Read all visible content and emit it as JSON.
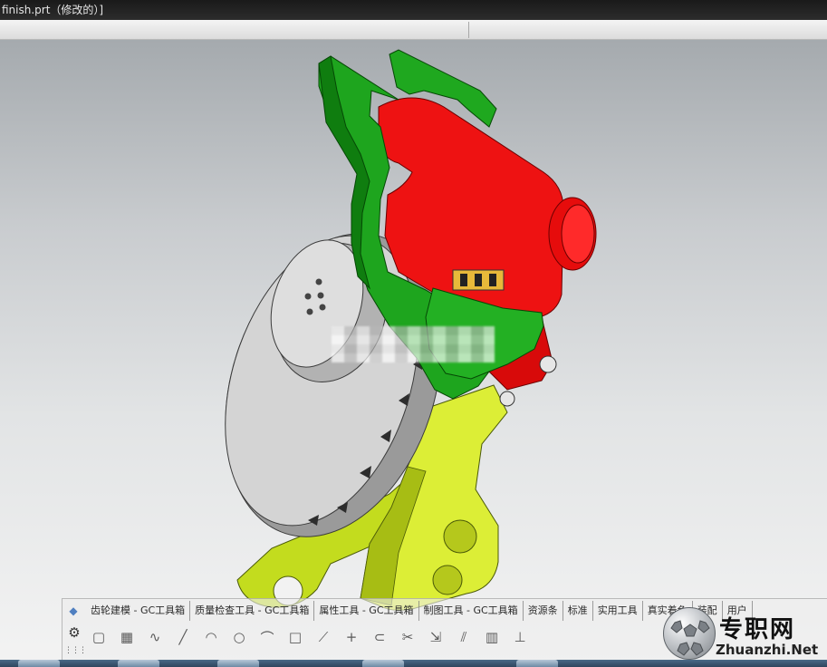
{
  "window": {
    "title": "finish.prt（修改的）]"
  },
  "ribbon": {
    "tabs": [
      "齿轮建模 - GC工具箱",
      "质量检查工具 - GC工具箱",
      "属性工具 - GC工具箱",
      "制图工具 - GC工具箱",
      "资源条",
      "标准",
      "实用工具",
      "真实着色",
      "装配",
      "用户"
    ],
    "tools": [
      {
        "name": "rectangle-select-icon",
        "glyph": "▢"
      },
      {
        "name": "grid-icon",
        "glyph": "▦"
      },
      {
        "name": "spline-icon",
        "glyph": "∿"
      },
      {
        "name": "line-icon",
        "glyph": "╱"
      },
      {
        "name": "arc-icon",
        "glyph": "◠"
      },
      {
        "name": "circle-icon",
        "glyph": "○"
      },
      {
        "name": "fillet-icon",
        "glyph": "⌒"
      },
      {
        "name": "rectangle-icon",
        "glyph": "□"
      },
      {
        "name": "polyline-icon",
        "glyph": "⟋"
      },
      {
        "name": "point-icon",
        "glyph": "+"
      },
      {
        "name": "offset-icon",
        "glyph": "⊂"
      },
      {
        "name": "trim-icon",
        "glyph": "✂"
      },
      {
        "name": "extend-icon",
        "glyph": "⇲"
      },
      {
        "name": "mirror-icon",
        "glyph": "⫽"
      },
      {
        "name": "pattern-icon",
        "glyph": "▥"
      },
      {
        "name": "constraint-icon",
        "glyph": "⊥"
      }
    ]
  },
  "watermark": {
    "name_cn": "专职网",
    "name_en": "Zhuanzhi.Net"
  },
  "colors": {
    "caliper_green": "#1fa11f",
    "housing_red": "#f01010",
    "bracket_yellow": "#d6e82a",
    "disc_gray": "#c2c2c2"
  }
}
